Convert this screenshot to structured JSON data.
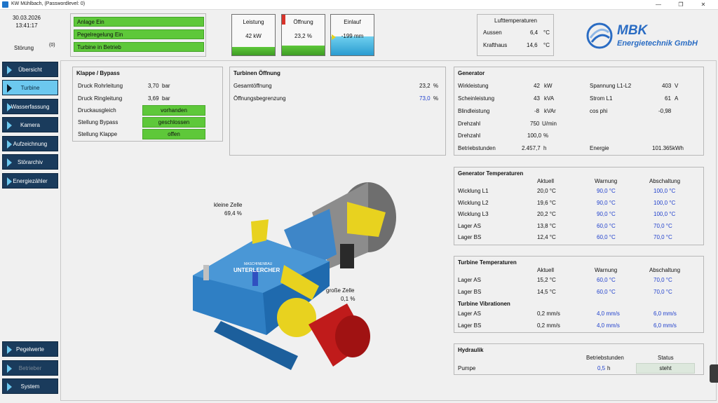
{
  "window": {
    "title": "KW Mühlbach,  (Passwordlevel: 0)"
  },
  "sidebar": {
    "date": "30.03.2026",
    "time": "13:41:17",
    "stoerung_label": "Störung",
    "stoerung_count": "(0)",
    "nav_top": [
      {
        "label": "Übersicht"
      },
      {
        "label": "Turbine"
      },
      {
        "label": "Wasserfassung"
      },
      {
        "label": "Kamera"
      },
      {
        "label": "Aufzeichnung"
      },
      {
        "label": "Störarchiv"
      },
      {
        "label": "Energiezähler"
      }
    ],
    "nav_bottom": [
      {
        "label": "Pegelwerte"
      },
      {
        "label": "Betrieber"
      },
      {
        "label": "System"
      }
    ]
  },
  "status": {
    "items": [
      "Anlage Ein",
      "Pegelregelung Ein",
      "Turbine in Betrieb"
    ]
  },
  "gauges": {
    "leistung": {
      "label": "Leistung",
      "value": "42 kW"
    },
    "oeffnung": {
      "label": "Öffnung",
      "value": "23,2 %",
      "fill_pct": 23.2
    },
    "einlauf": {
      "label": "Einlauf",
      "value": "-199 mm"
    }
  },
  "lufttemperaturen": {
    "title": "Lufttemperaturen",
    "rows": [
      {
        "label": "Aussen",
        "value": "6,4",
        "unit": "°C"
      },
      {
        "label": "Krafthaus",
        "value": "14,6",
        "unit": "°C"
      }
    ]
  },
  "logo": {
    "name": "MBK",
    "sub": "Energietechnik GmbH"
  },
  "klappe": {
    "title": "Klappe / Bypass",
    "rows": [
      {
        "label": "Druck Rohrleitung",
        "value": "3,70",
        "unit": "bar"
      },
      {
        "label": "Druck Ringleitung",
        "value": "3,69",
        "unit": "bar"
      }
    ],
    "states": [
      {
        "label": "Druckausgleich",
        "state": "vorhanden"
      },
      {
        "label": "Stellung Bypass",
        "state": "geschlossen"
      },
      {
        "label": "Stellung Klappe",
        "state": "offen"
      }
    ]
  },
  "turbinen_oeffnung": {
    "title": "Turbinen Öffnung",
    "rows": [
      {
        "label": "Gesamtöffnung",
        "value": "23,2",
        "unit": "%"
      },
      {
        "label": "Öffnungsbegrenzung",
        "value": "73,0",
        "unit": "%"
      }
    ]
  },
  "generator": {
    "title": "Generator",
    "left": [
      {
        "label": "Wirkleistung",
        "value": "42",
        "unit": "kW"
      },
      {
        "label": "Scheinleistung",
        "value": "43",
        "unit": "kVA"
      },
      {
        "label": "Blindleistung",
        "value": "-8",
        "unit": "kVAr"
      },
      {
        "label": "Drehzahl",
        "value": "750",
        "unit": "U/min"
      },
      {
        "label": "Drehzahl",
        "value": "100,0",
        "unit": "%"
      },
      {
        "label": "Betriebstunden",
        "value": "2.457,7",
        "unit": "h"
      }
    ],
    "right": [
      {
        "label": "Spannung L1-L2",
        "value": "403",
        "unit": "V"
      },
      {
        "label": "Strom L1",
        "value": "61",
        "unit": "A"
      },
      {
        "label": "cos phi",
        "value": "-0,98",
        "unit": ""
      },
      {
        "label": "Energie",
        "value": "101.365",
        "unit": "kWh"
      }
    ]
  },
  "gen_temp": {
    "title": "Generator Temperaturen",
    "headers": [
      "Aktuell",
      "Warnung",
      "Abschaltung"
    ],
    "rows": [
      {
        "label": "Wicklung L1",
        "aktuell": "20,0 °C",
        "warnung": "90,0 °C",
        "abschaltung": "100,0 °C"
      },
      {
        "label": "Wicklung L2",
        "aktuell": "19,6 °C",
        "warnung": "90,0 °C",
        "abschaltung": "100,0 °C"
      },
      {
        "label": "Wicklung L3",
        "aktuell": "20,2 °C",
        "warnung": "90,0 °C",
        "abschaltung": "100,0 °C"
      },
      {
        "label": "Lager AS",
        "aktuell": "13,8 °C",
        "warnung": "60,0 °C",
        "abschaltung": "70,0 °C"
      },
      {
        "label": "Lager BS",
        "aktuell": "12,4 °C",
        "warnung": "60,0 °C",
        "abschaltung": "70,0 °C"
      }
    ]
  },
  "turb_temp": {
    "title": "Turbine Temperaturen",
    "headers": [
      "Aktuell",
      "Warnung",
      "Abschaltung"
    ],
    "rows": [
      {
        "label": "Lager AS",
        "aktuell": "15,2 °C",
        "warnung": "60,0 °C",
        "abschaltung": "70,0 °C"
      },
      {
        "label": "Lager BS",
        "aktuell": "14,5 °C",
        "warnung": "60,0 °C",
        "abschaltung": "70,0 °C"
      }
    ],
    "vib_title": "Turbine Vibrationen",
    "vib_rows": [
      {
        "label": "Lager AS",
        "aktuell": "0,2 mm/s",
        "warnung": "4,0 mm/s",
        "abschaltung": "6,0 mm/s"
      },
      {
        "label": "Lager BS",
        "aktuell": "0,2 mm/s",
        "warnung": "4,0 mm/s",
        "abschaltung": "6,0 mm/s"
      }
    ]
  },
  "hydraulik": {
    "title": "Hydraulik",
    "headers": [
      "Betriebstunden",
      "Status"
    ],
    "row": {
      "label": "Pumpe",
      "value": "0,5",
      "unit": "h",
      "status": "steht"
    }
  },
  "turbine_image": {
    "brand_line1": "MASCHINENBAU",
    "brand_line2": "UNTERLERCHER",
    "kleine_zelle_label": "kleine Zelle",
    "kleine_zelle_value": "69,4 %",
    "grosse_zelle_label": "große Zelle",
    "grosse_zelle_value": "0,1 %"
  },
  "colors": {
    "green": "#5ec83a",
    "nav": "#1a3b5c",
    "nav_active": "#6cc8ef",
    "blue_value": "#1f3fcc",
    "logo": "#2a6cc3"
  }
}
